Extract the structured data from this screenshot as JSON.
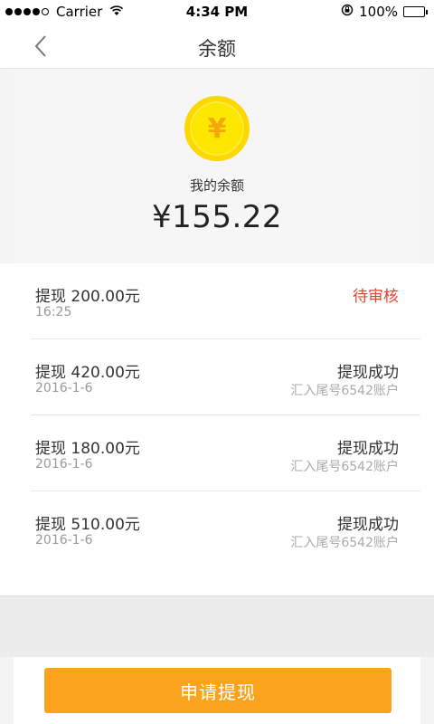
{
  "status_bar": {
    "carrier": "Carrier",
    "time": "4:34 PM",
    "battery": "100%"
  },
  "nav": {
    "title": "余额"
  },
  "balance": {
    "currency_symbol": "¥",
    "label": "我的余额",
    "amount": "¥155.22"
  },
  "records": [
    {
      "title": "提现 200.00元",
      "date": "16:25",
      "status": "待审核",
      "note": ""
    },
    {
      "title": "提现 420.00元",
      "date": "2016-1-6",
      "status": "提现成功",
      "note": "汇入尾号6542账户"
    },
    {
      "title": "提现 180.00元",
      "date": "2016-1-6",
      "status": "提现成功",
      "note": "汇入尾号6542账户"
    },
    {
      "title": "提现 510.00元",
      "date": "2016-1-6",
      "status": "提现成功",
      "note": "汇入尾号6542账户"
    }
  ],
  "footer": {
    "withdraw_label": "申请提现"
  },
  "colors": {
    "accent": "#fba31c",
    "pending": "#e0442a",
    "coin": "#fde600"
  },
  "icons": {
    "back": "chevron-left-icon",
    "coin": "yuan-coin-icon",
    "wifi": "wifi-icon",
    "lock": "rotation-lock-icon",
    "battery": "battery-icon"
  }
}
